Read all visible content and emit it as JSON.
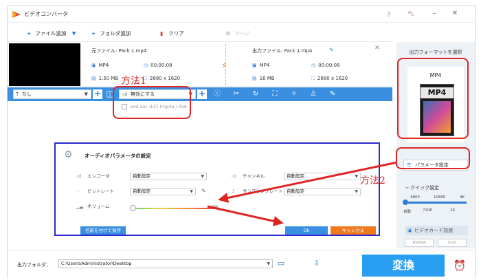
{
  "app": {
    "title": "ビデオコンバータ"
  },
  "toolbar": {
    "add_file": "ファイル追加",
    "add_folder": "フォルダ追加",
    "clear": "クリア",
    "merge": "マージ"
  },
  "file": {
    "source_label": "元ファイル: Pack 1.mp4",
    "output_label": "出力ファイル: Pack 1.mp4",
    "src_format": "MP4",
    "src_duration": "00:00:08",
    "src_size": "1.50 MB",
    "src_resolution": "2880 x 1620",
    "out_format": "MP4",
    "out_duration": "00:00:08",
    "out_size": "16 MB",
    "out_resolution": "2880 x 1620"
  },
  "edit_bar": {
    "subtitle_value": "なし",
    "audio_value": "無効にする",
    "audio_track_option": "und aac (LC) (mp4a / 0x6"
  },
  "annotations": {
    "method1": "方法1",
    "method2": "方法2",
    "highlight_color": "#e02424",
    "arrow_color": "#e02424"
  },
  "dialog": {
    "title": "オーディオパラメータの設定",
    "encoder_label": "エンコーダ",
    "encoder_value": "自動設定",
    "bitrate_label": "ビットレート",
    "bitrate_value": "自動設定",
    "volume_label": "ボリューム",
    "volume_value": "0%",
    "channel_label": "チャンネル",
    "channel_value": "自動設定",
    "samplerate_label": "サンプリングレート",
    "samplerate_value": "自動設定",
    "save_as_label": "名前を付けて保存",
    "ok_label": "Ok",
    "cancel_label": "キャンセル"
  },
  "right_panel": {
    "format_label": "出力フォーマットを選択",
    "format_name": "MP4",
    "format_card_label": "MP4",
    "param_settings": "パラメータ設定",
    "quick_settings": "クイック設定",
    "quality_top": [
      "480P",
      "1080P",
      "4K"
    ],
    "quality_bottom": [
      "自動",
      "720P",
      "2K"
    ],
    "gpu_accel": "ビデオカード加速",
    "chip_nvidia": "NVIDIA",
    "chip_intel": "Intel"
  },
  "footer": {
    "output_folder_label": "出力フォルダ：",
    "output_path": "C:\\Users\\Administrator\\Desktop",
    "convert_label": "変換"
  },
  "colors": {
    "accent_blue": "#3a8fe0",
    "convert_blue": "#2a9ef0",
    "cancel_orange": "#f07a1e",
    "dialog_border": "#2b2bd0"
  }
}
